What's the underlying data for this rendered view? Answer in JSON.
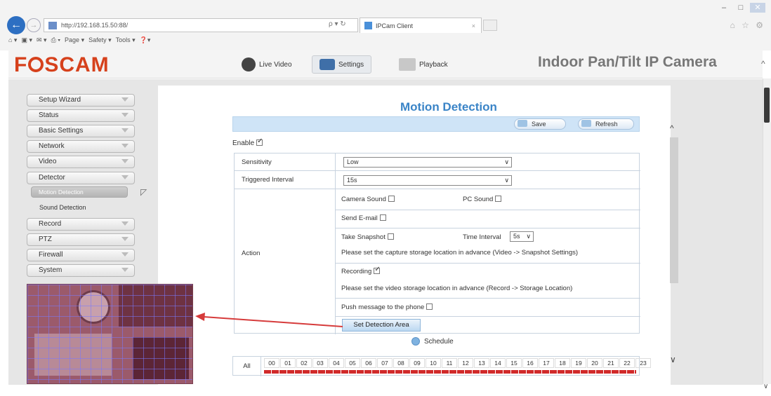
{
  "browser": {
    "url": "http://192.168.15.50:88/",
    "tab_title": "IPCam Client",
    "window_controls": [
      "–",
      "□",
      "✕"
    ],
    "menu": [
      "Page ▾",
      "Safety ▾",
      "Tools ▾"
    ],
    "right_icons": "⌂ ☆ ⚙"
  },
  "app": {
    "logo": {
      "part1": "F",
      "part2": "SCAM"
    },
    "product_title": "Indoor Pan/Tilt IP Camera",
    "nav": [
      {
        "label": "Live Video"
      },
      {
        "label": "Settings"
      },
      {
        "label": "Playback"
      }
    ]
  },
  "sidebar": {
    "items": [
      {
        "label": "Setup Wizard"
      },
      {
        "label": "Status"
      },
      {
        "label": "Basic Settings"
      },
      {
        "label": "Network"
      },
      {
        "label": "Video"
      },
      {
        "label": "Detector"
      },
      {
        "label": "Motion Detection"
      },
      {
        "label": "Sound Detection"
      },
      {
        "label": "Record"
      },
      {
        "label": "PTZ"
      },
      {
        "label": "Firewall"
      },
      {
        "label": "System"
      }
    ]
  },
  "main": {
    "title": "Motion Detection",
    "save_label": "Save",
    "refresh_label": "Refresh",
    "enable_label": "Enable",
    "sensitivity_label": "Sensitivity",
    "sensitivity_value": "Low",
    "interval_label": "Triggered Interval",
    "interval_value": "15s",
    "action_label": "Action",
    "camera_sound": "Camera Sound",
    "pc_sound": "PC Sound",
    "send_email": "Send E-mail",
    "take_snapshot": "Take Snapshot",
    "time_interval_label": "Time Interval",
    "time_interval_value": "5s",
    "snapshot_note": "Please set the capture storage location in advance (Video -> Snapshot Settings)",
    "recording": "Recording",
    "recording_note": "Please set the video storage location in advance (Record -> Storage Location)",
    "push_message": "Push message to the phone",
    "set_area_button": "Set Detection Area",
    "schedule_label": "Schedule",
    "all_label": "All",
    "hours": [
      "00",
      "01",
      "02",
      "03",
      "04",
      "05",
      "06",
      "07",
      "08",
      "09",
      "10",
      "11",
      "12",
      "13",
      "14",
      "15",
      "16",
      "17",
      "18",
      "19",
      "20",
      "21",
      "22",
      "23"
    ]
  }
}
